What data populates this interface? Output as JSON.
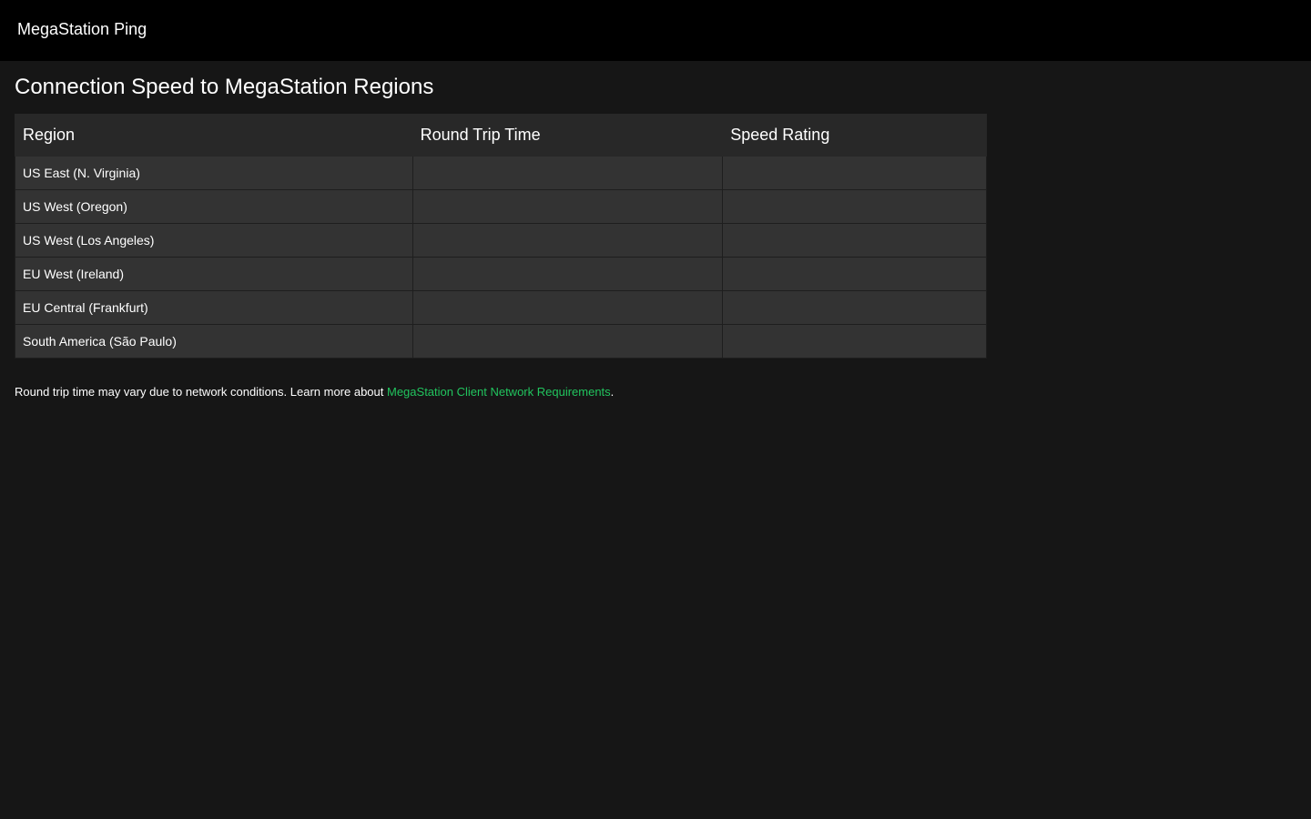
{
  "app": {
    "title": "MegaStation Ping"
  },
  "page": {
    "title": "Connection Speed to MegaStation Regions"
  },
  "table": {
    "headers": [
      "Region",
      "Round Trip Time",
      "Speed Rating"
    ],
    "rows": [
      {
        "region": "US East (N. Virginia)",
        "rtt": "",
        "rating": ""
      },
      {
        "region": "US West (Oregon)",
        "rtt": "",
        "rating": ""
      },
      {
        "region": "US West (Los Angeles)",
        "rtt": "",
        "rating": ""
      },
      {
        "region": "EU West (Ireland)",
        "rtt": "",
        "rating": ""
      },
      {
        "region": "EU Central (Frankfurt)",
        "rtt": "",
        "rating": ""
      },
      {
        "region": "South America (São Paulo)",
        "rtt": "",
        "rating": ""
      }
    ]
  },
  "footer": {
    "text_before": "Round trip time may vary due to network conditions. Learn more about ",
    "link_text": "MegaStation Client Network Requirements",
    "text_after": "."
  },
  "colors": {
    "topbar_bg": "#000000",
    "page_bg": "#161616",
    "header_bg": "#282828",
    "row_bg": "#333333",
    "link": "#21c45e"
  }
}
